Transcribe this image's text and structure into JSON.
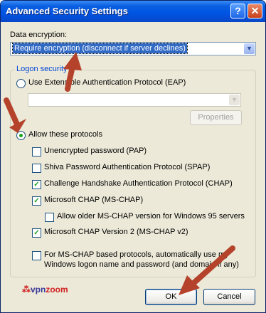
{
  "window": {
    "title": "Advanced Security Settings",
    "help_label": "?",
    "close_label": "✕"
  },
  "data_encryption": {
    "label": "Data encryption:",
    "selected": "Require encryption (disconnect if server declines)",
    "arrow": "▼"
  },
  "logon_security": {
    "legend": "Logon security",
    "eap_option": "Use Extensible Authentication Protocol (EAP)",
    "eap_select_value": "",
    "properties_label": "Properties",
    "allow_option": "Allow these protocols",
    "protocols": [
      {
        "label": "Unencrypted password (PAP)",
        "checked": false
      },
      {
        "label": "Shiva Password Authentication Protocol (SPAP)",
        "checked": false
      },
      {
        "label": "Challenge Handshake Authentication Protocol (CHAP)",
        "checked": true
      },
      {
        "label": "Microsoft CHAP (MS-CHAP)",
        "checked": true
      },
      {
        "label": "Allow older MS-CHAP version for Windows 95 servers",
        "checked": false
      },
      {
        "label": "Microsoft CHAP Version 2 (MS-CHAP v2)",
        "checked": true
      }
    ],
    "auto_logon_line1": "For MS-CHAP based protocols, automatically use my",
    "auto_logon_line2": "Windows logon name and password (and domain if any)"
  },
  "footer": {
    "logo_part1": "vpn",
    "logo_part2": "zoom",
    "ok_label": "OK",
    "cancel_label": "Cancel"
  },
  "colors": {
    "title_bar": "#0054e3",
    "annotation_arrow": "#b5422a",
    "check_mark": "#21a121"
  },
  "check_glyph": "✓"
}
